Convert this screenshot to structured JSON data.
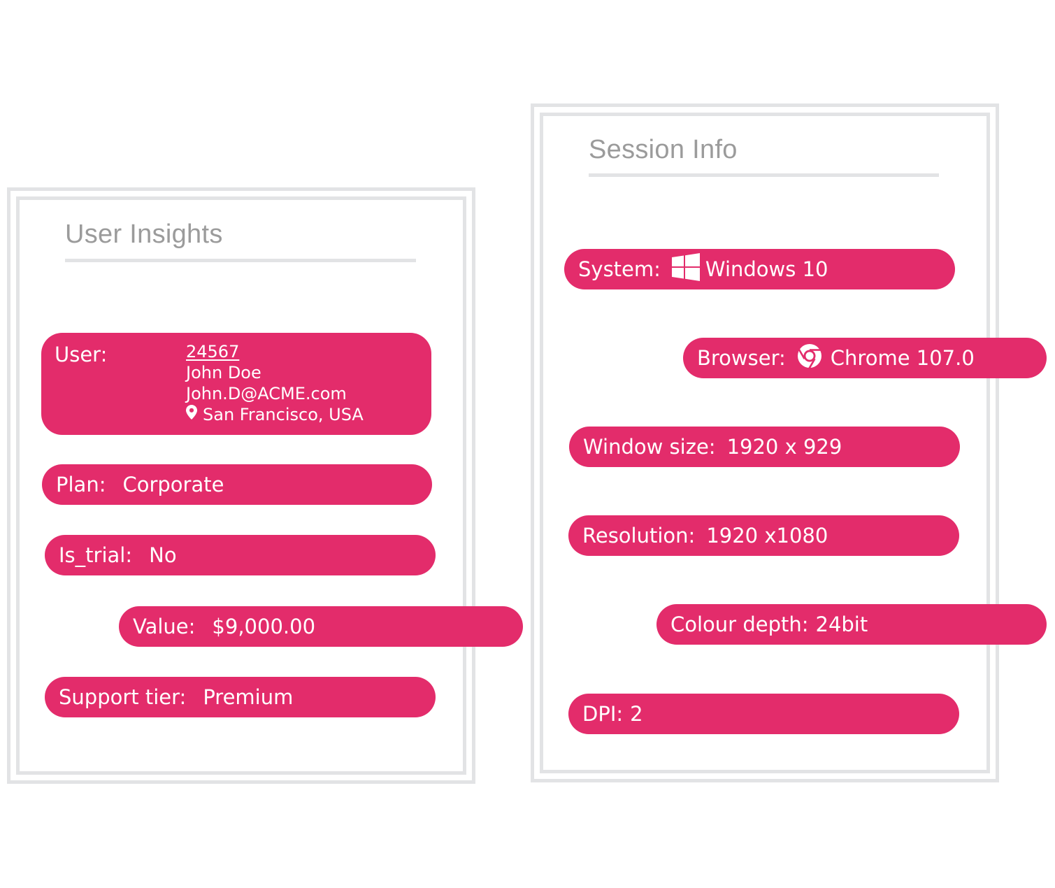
{
  "user_insights": {
    "title": "User Insights",
    "user": {
      "label": "User:",
      "id": "24567",
      "name": "John Doe",
      "email": "John.D@ACME.com",
      "location": "San Francisco, USA",
      "location_icon": "map-pin-icon"
    },
    "plan": {
      "label": "Plan:",
      "value": "Corporate"
    },
    "is_trial": {
      "label": "Is_trial:",
      "value": "No"
    },
    "value": {
      "label": "Value:",
      "value": "$9,000.00"
    },
    "support_tier": {
      "label": "Support tier:",
      "value": "Premium"
    }
  },
  "session_info": {
    "title": "Session Info",
    "system": {
      "label": "System:",
      "value": "Windows 10",
      "icon": "windows-logo-icon"
    },
    "browser": {
      "label": "Browser:",
      "value": "Chrome 107.0",
      "icon": "chrome-logo-icon"
    },
    "window_size": {
      "label": "Window size:",
      "value": "1920 x 929"
    },
    "resolution": {
      "label": "Resolution:",
      "value": "1920 x1080"
    },
    "colour_depth": {
      "label": "Colour depth:",
      "value": "24bit"
    },
    "dpi": {
      "label": "DPI:",
      "value": "2"
    }
  },
  "colors": {
    "accent": "#e32c6b",
    "frame": "#e2e3e5",
    "heading": "#9b9b9b",
    "text_on_accent": "#ffffff"
  }
}
